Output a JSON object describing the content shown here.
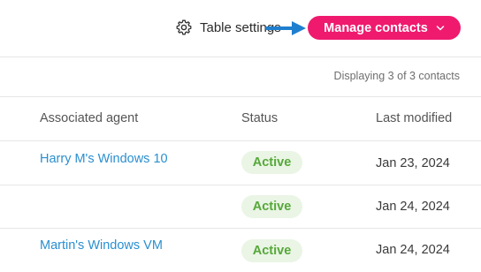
{
  "toolbar": {
    "table_settings_label": "Table settings",
    "manage_contacts_label": "Manage contacts"
  },
  "table": {
    "count_text": "Displaying 3 of 3 contacts",
    "columns": {
      "agent": "Associated agent",
      "status": "Status",
      "last_modified": "Last modified"
    },
    "rows": [
      {
        "agent": "Harry M's Windows 10",
        "status": "Active",
        "last_modified": "Jan 23, 2024"
      },
      {
        "agent": "",
        "status": "Active",
        "last_modified": "Jan 24, 2024"
      },
      {
        "agent": "Martin's Windows VM",
        "status": "Active",
        "last_modified": "Jan 24, 2024"
      }
    ]
  },
  "colors": {
    "accent": "#ef1a6e",
    "link": "#2a8fd0",
    "status_active_text": "#56a83a",
    "status_active_bg": "#eaf5e5",
    "annotation_arrow": "#1f7fcf"
  },
  "icons": {
    "settings": "gear-icon",
    "dropdown": "chevron-down-icon",
    "annotation": "arrow-right-icon"
  }
}
